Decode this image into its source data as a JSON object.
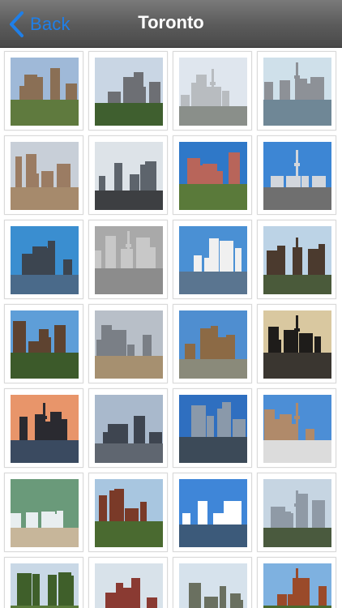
{
  "navbar": {
    "back_label": "Back",
    "title": "Toronto",
    "back_color": "#1f7fe8"
  },
  "gallery": {
    "photos": [
      {
        "subject": "stone-building-photo",
        "sky": "#9fb9d8",
        "ground": "#5f7a3e",
        "accent": "#8a6f55"
      },
      {
        "subject": "downtown-towers-photo",
        "sky": "#c9d6e4",
        "ground": "#3f5f2f",
        "accent": "#6d6f74"
      },
      {
        "subject": "condo-street-photo",
        "sky": "#dfe6ee",
        "ground": "#8a8f8a",
        "accent": "#b8bcc0"
      },
      {
        "subject": "cn-tower-skyline-photo",
        "sky": "#cfe0ea",
        "ground": "#6f8796",
        "accent": "#8d9197"
      },
      {
        "subject": "rooftop-campus-photo",
        "sky": "#c8cfd8",
        "ground": "#a68a6c",
        "accent": "#9b7c63"
      },
      {
        "subject": "waterfront-winter-photo",
        "sky": "#dde3e8",
        "ground": "#3d3f42",
        "accent": "#5d646c"
      },
      {
        "subject": "red-brick-tower-photo",
        "sky": "#2f78c8",
        "ground": "#5a7a3a",
        "accent": "#b8655a"
      },
      {
        "subject": "glass-tower-street-photo",
        "sky": "#3d86d4",
        "ground": "#6f6f6f",
        "accent": "#d2d6dc"
      },
      {
        "subject": "lake-skyline-photo",
        "sky": "#3a8ed0",
        "ground": "#4a6a8a",
        "accent": "#3c4550"
      },
      {
        "subject": "aerial-downtown-photo",
        "sky": "#a9a9a9",
        "ground": "#8c8c8c",
        "accent": "#c8c8c8"
      },
      {
        "subject": "marina-photo",
        "sky": "#4a90d4",
        "ground": "#5a7590",
        "accent": "#f0f0f0"
      },
      {
        "subject": "church-spire-photo",
        "sky": "#bcd3e6",
        "ground": "#4a5a3a",
        "accent": "#4b3a2e"
      },
      {
        "subject": "totem-pole-photo",
        "sky": "#5e9ed8",
        "ground": "#3c5a2a",
        "accent": "#5e4330"
      },
      {
        "subject": "financial-district-photo",
        "sky": "#b8bfc8",
        "ground": "#a69070",
        "accent": "#7a7f86"
      },
      {
        "subject": "cathedral-photo",
        "sky": "#4f8ed0",
        "ground": "#8a8a7a",
        "accent": "#8c6a45"
      },
      {
        "subject": "sunset-skyline-photo",
        "sky": "#d9c8a0",
        "ground": "#3a3630",
        "accent": "#1e1c1a"
      },
      {
        "subject": "dusk-cn-tower-photo",
        "sky": "#e8956a",
        "ground": "#3a4a60",
        "accent": "#2a2a30"
      },
      {
        "subject": "office-towers-photo",
        "sky": "#a9b9cc",
        "ground": "#5f6670",
        "accent": "#3e4550"
      },
      {
        "subject": "city-hall-photo",
        "sky": "#2f6fc0",
        "ground": "#3c4a58",
        "accent": "#8a99aa"
      },
      {
        "subject": "snowy-residential-photo",
        "sky": "#4c8ed6",
        "ground": "#dcdcdc",
        "accent": "#b08a6a"
      },
      {
        "subject": "fountain-photo",
        "sky": "#6a9a7a",
        "ground": "#c7b69a",
        "accent": "#e8eef0"
      },
      {
        "subject": "victorian-house-photo",
        "sky": "#a8c6e0",
        "ground": "#4a6a30",
        "accent": "#7a3a28"
      },
      {
        "subject": "cloudy-skyline-photo",
        "sky": "#3f86d8",
        "ground": "#3c5a7a",
        "accent": "#ffffff"
      },
      {
        "subject": "twin-towers-photo",
        "sky": "#c6d5e2",
        "ground": "#4a5a3e",
        "accent": "#8f9aa6"
      },
      {
        "subject": "park-trees-photo",
        "sky": "#c9d8e6",
        "ground": "#5a7a3a",
        "accent": "#3f5f2a"
      },
      {
        "subject": "brick-street-photo",
        "sky": "#d8e2ea",
        "ground": "#6f7a5a",
        "accent": "#8a3a32"
      },
      {
        "subject": "sports-field-photo",
        "sky": "#d6e2ec",
        "ground": "#5f8a3a",
        "accent": "#6a7060"
      },
      {
        "subject": "clock-tower-photo",
        "sky": "#7eb1e0",
        "ground": "#4a6a2e",
        "accent": "#9a4a2a"
      }
    ]
  }
}
